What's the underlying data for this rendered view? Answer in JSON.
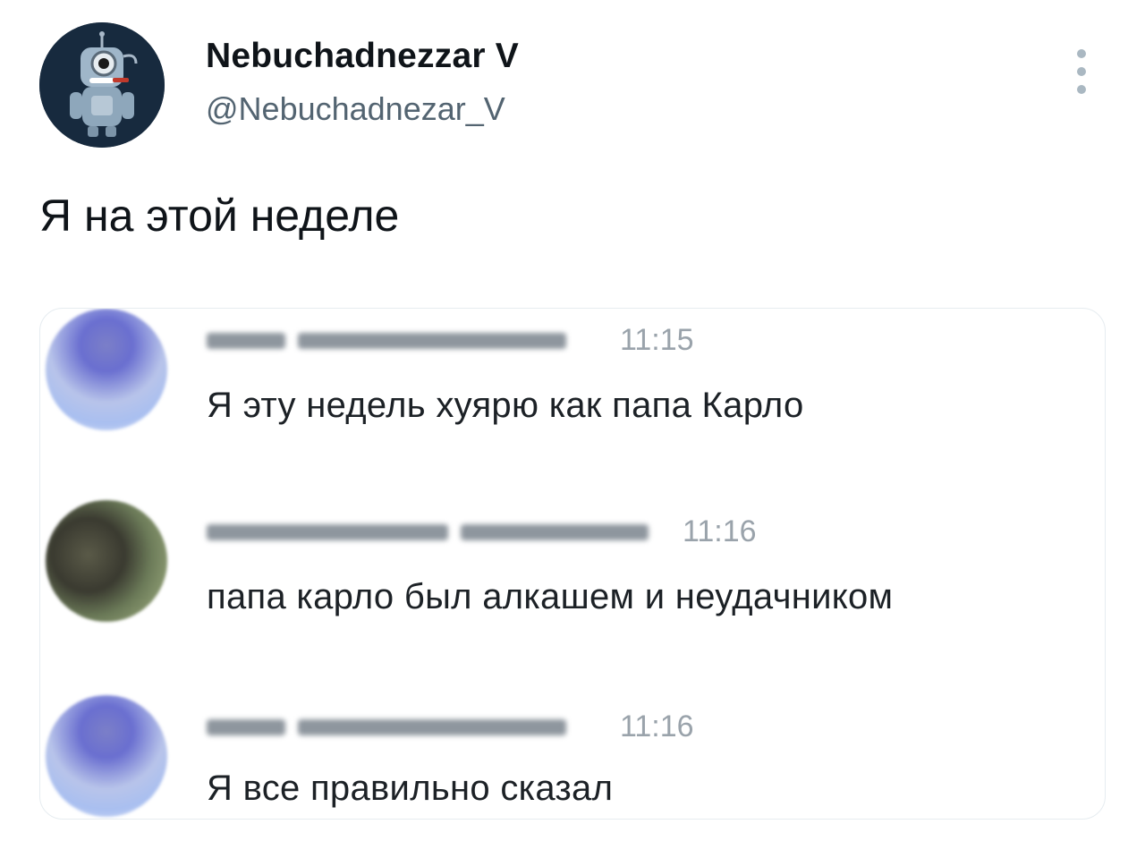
{
  "tweet": {
    "author_name": "Nebuchadnezzar V",
    "author_handle": "@Nebuchadnezar_V",
    "text": "Я на этой неделе",
    "more_icon": "more-vertical-icon",
    "avatar_icon": "robot-avatar"
  },
  "chat": {
    "messages": [
      {
        "time": "11:15",
        "text": "Я эту недель хуярю как папа Карло",
        "avatar_icon": "blurred-avatar-blue"
      },
      {
        "time": "11:16",
        "text": "папа карло был алкашем и неудачником",
        "avatar_icon": "blurred-avatar-dark"
      },
      {
        "time": "11:16",
        "text": "Я все правильно сказал",
        "avatar_icon": "blurred-avatar-blue"
      }
    ]
  },
  "colors": {
    "text_primary": "#0f1419",
    "text_secondary": "#536471",
    "avatar_bg": "#172a3e",
    "card_border": "#e6ecf0"
  }
}
